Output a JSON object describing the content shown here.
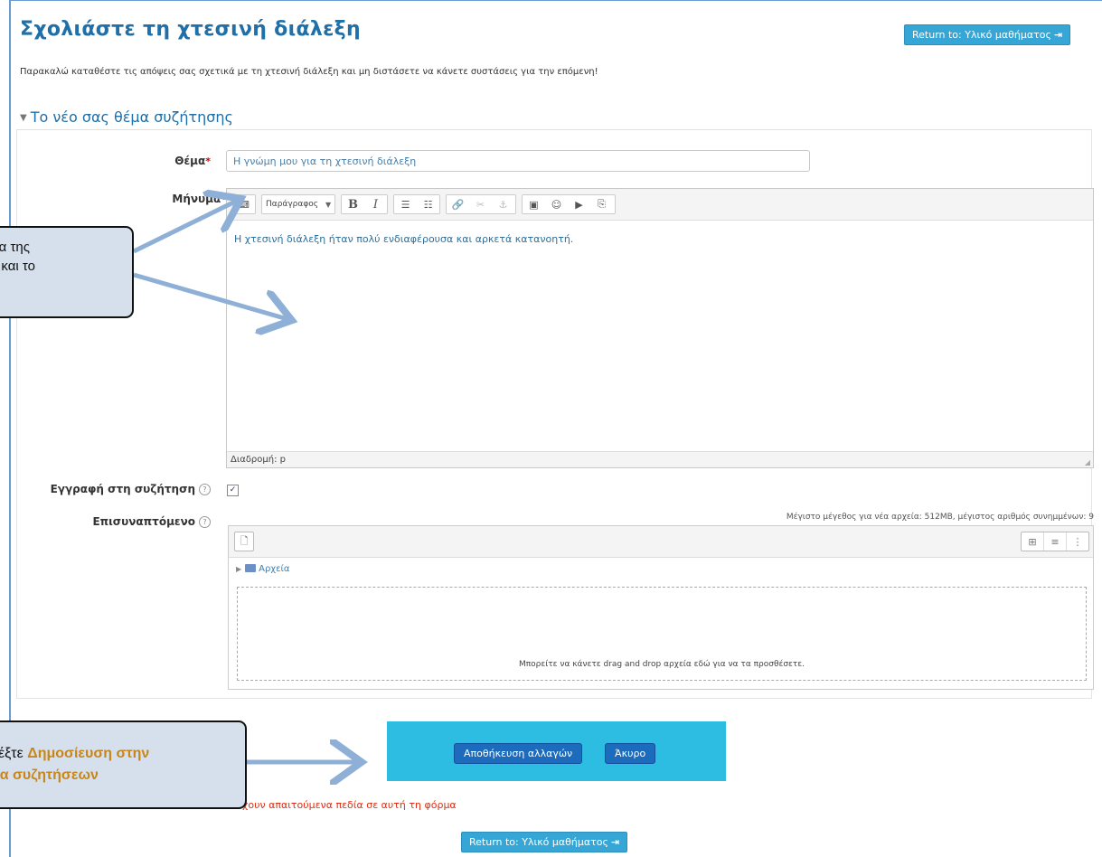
{
  "page": {
    "title": "Σχολιάστε τη χτεσινή διάλεξη",
    "return_button": "Return to: Υλικό μαθήματος",
    "intro_text": "Παρακαλώ καταθέστε τις απόψεις σας σχετικά με τη χτεσινή διάλεξη και μη διστάσετε να κάνετε συστάσεις για την επόμενη!"
  },
  "section": {
    "title": "Το νέο σας θέμα συζήτησης"
  },
  "form": {
    "subject_label": "Θέμα",
    "subject_value": "Η γνώμη μου για τη χτεσινή διάλεξη",
    "message_label": "Μήνυμα",
    "paragraph_select": "Παράγραφος",
    "message_text": "Η χτεσινή διάλεξη ήταν πολύ ενδιαφέρουσα και αρκετά κατανοητή.",
    "path_text": "Διαδρομή: p",
    "subscribe_label": "Εγγραφή στη συζήτηση",
    "subscribe_checked": true,
    "attachment_label": "Επισυναπτόμενο",
    "attachment_limits": "Μέγιστο μέγεθος για νέα αρχεία: 512MB, μέγιστος αριθμός συνημμένων: 9",
    "folder_label": "Αρχεία",
    "dropzone_text": "Μπορείτε να κάνετε drag and drop αρχεία εδώ για να τα προσθέσετε.",
    "save_button": "Αποθήκευση αλλαγών",
    "cancel_button": "Άκυρο",
    "required_note": "χουν απαιτούμενα πεδία σε αυτή τη φόρμα"
  },
  "callouts": {
    "c1_line1": "μα της",
    "c1_line2": "ς και το",
    "c2_line1_prefix": "λέξτε ",
    "c2_line1_highlight": "Δημοσίευση στην",
    "c2_line2_highlight": "δα συζητήσεων"
  },
  "colors": {
    "accent": "#1f6fa8",
    "return_button": "#35a6d6",
    "action_box": "#2ebde2",
    "primary_button": "#1d6bbd",
    "required_text": "#e02d12",
    "callout_bg": "#d5e0ec",
    "callout_highlight": "#c8861a",
    "annotation_arrow": "#8fb0d6"
  }
}
